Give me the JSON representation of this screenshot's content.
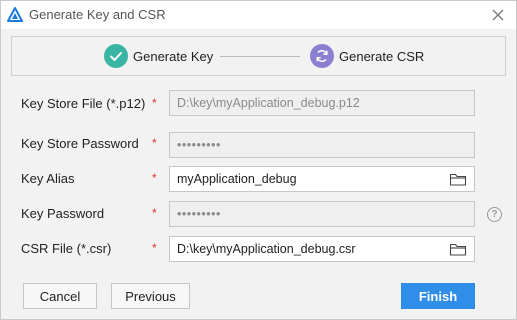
{
  "window": {
    "title": "Generate Key and CSR",
    "icon": "deveco-logo-icon"
  },
  "steps": [
    {
      "label": "Generate Key",
      "state": "done",
      "color": "#3ab4a3",
      "icon": "check-icon"
    },
    {
      "label": "Generate CSR",
      "state": "active",
      "color": "#8a7fd0",
      "icon": "refresh-icon"
    }
  ],
  "form": {
    "key_store_file": {
      "label": "Key Store File (*.p12)",
      "required": "*",
      "value": "D:\\key\\myApplication_debug.p12",
      "enabled": false
    },
    "key_store_password": {
      "label": "Key Store Password",
      "required": "*",
      "value": "•••••••••",
      "enabled": false
    },
    "key_alias": {
      "label": "Key Alias",
      "required": "*",
      "value": "myApplication_debug",
      "enabled": true
    },
    "key_password": {
      "label": "Key Password",
      "required": "*",
      "value": "•••••••••",
      "enabled": false
    },
    "csr_file": {
      "label": "CSR File (*.csr)",
      "required": "*",
      "value": "D:\\key\\myApplication_debug.csr",
      "enabled": true
    }
  },
  "help": {
    "glyph": "?"
  },
  "buttons": {
    "cancel": "Cancel",
    "previous": "Previous",
    "finish": "Finish"
  },
  "colors": {
    "accent": "#2e8ee8",
    "required": "#e3342f",
    "done_step": "#3ab4a3",
    "active_step": "#8a7fd0"
  }
}
